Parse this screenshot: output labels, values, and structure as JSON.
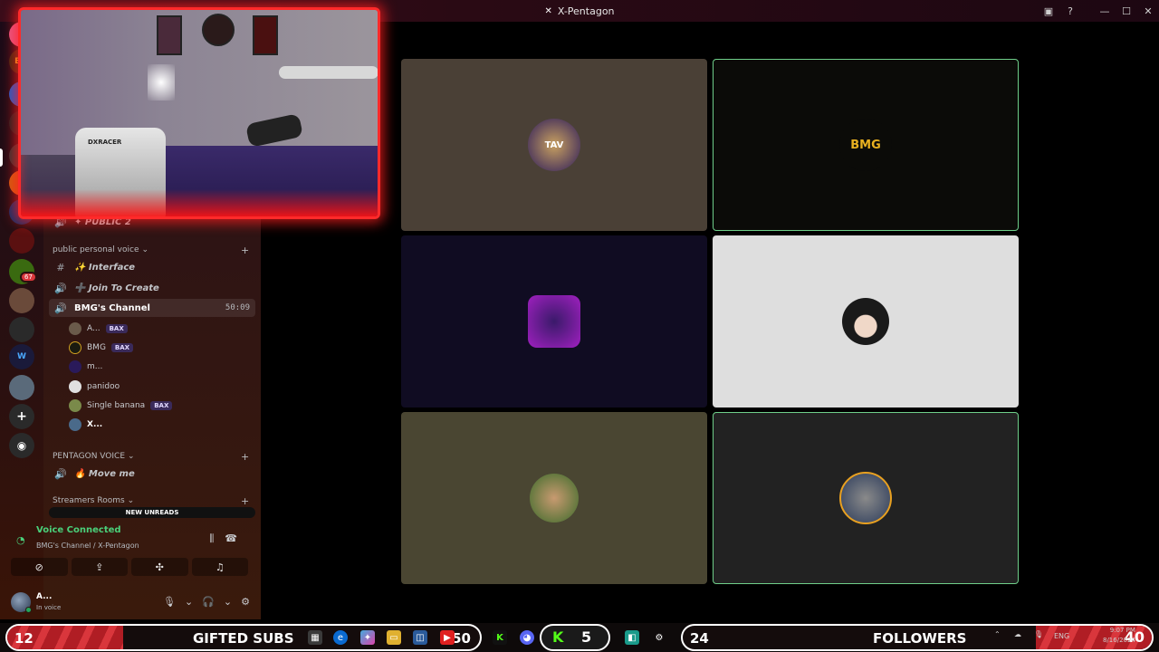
{
  "window": {
    "title": "X-Pentagon",
    "logo": "✕"
  },
  "sidebar": {
    "partial_channel": "✦ PUBLIC 2",
    "categories": [
      {
        "name": "public personal voice"
      },
      {
        "name": "PENTAGON VOICE"
      },
      {
        "name": "Streamers Rooms"
      }
    ],
    "channels": [
      {
        "icon": "#",
        "label": "✨ Interface"
      },
      {
        "icon": "🔊",
        "label": "➕ Join To Create"
      },
      {
        "icon": "🔊",
        "label": "BMG's Channel",
        "timer": "50:09"
      },
      {
        "icon": "🔊",
        "label": "🔥 Move me"
      }
    ],
    "voice_users": [
      {
        "name": "A...",
        "tag": "BAX"
      },
      {
        "name": "BMG",
        "tag": "BAX"
      },
      {
        "name": "m...",
        "tag": ""
      },
      {
        "name": "panidoo",
        "tag": ""
      },
      {
        "name": "Single banana",
        "tag": "BAX"
      },
      {
        "name": "X...",
        "tag": ""
      }
    ],
    "new_unreads": "NEW UNREADS"
  },
  "voice": {
    "status": "Voice Connected",
    "location": "BMG's Channel / X-Pentagon"
  },
  "user": {
    "name": "A...",
    "status": "In voice"
  },
  "stage": {
    "tiles": [
      {
        "bg": "#4a4036",
        "avatar": "TAV",
        "speaking": false
      },
      {
        "bg": "#0b0b08",
        "avatar": "BMG",
        "speaking": true
      },
      {
        "bg": "#100c22",
        "avatar": "",
        "speaking": false
      },
      {
        "bg": "#dedede",
        "avatar": "",
        "speaking": false
      },
      {
        "bg": "#4a4632",
        "avatar": "",
        "speaking": false
      },
      {
        "bg": "#222222",
        "avatar": "",
        "speaking": true
      }
    ]
  },
  "stream_overlay": {
    "left_count": "12",
    "left_label": "GIFTED SUBS",
    "left_count2": "50",
    "mid_count": "5",
    "right_count": "24",
    "right_label": "FOLLOWERS",
    "right_count2": "40"
  },
  "tray": {
    "lang": "ENG",
    "time": "9:07 PM",
    "date": "8/16/2024"
  },
  "colors": {
    "accent_green": "#4ad07a",
    "overlay_red": "#d9363c",
    "cam_border": "#ff2a2a"
  }
}
